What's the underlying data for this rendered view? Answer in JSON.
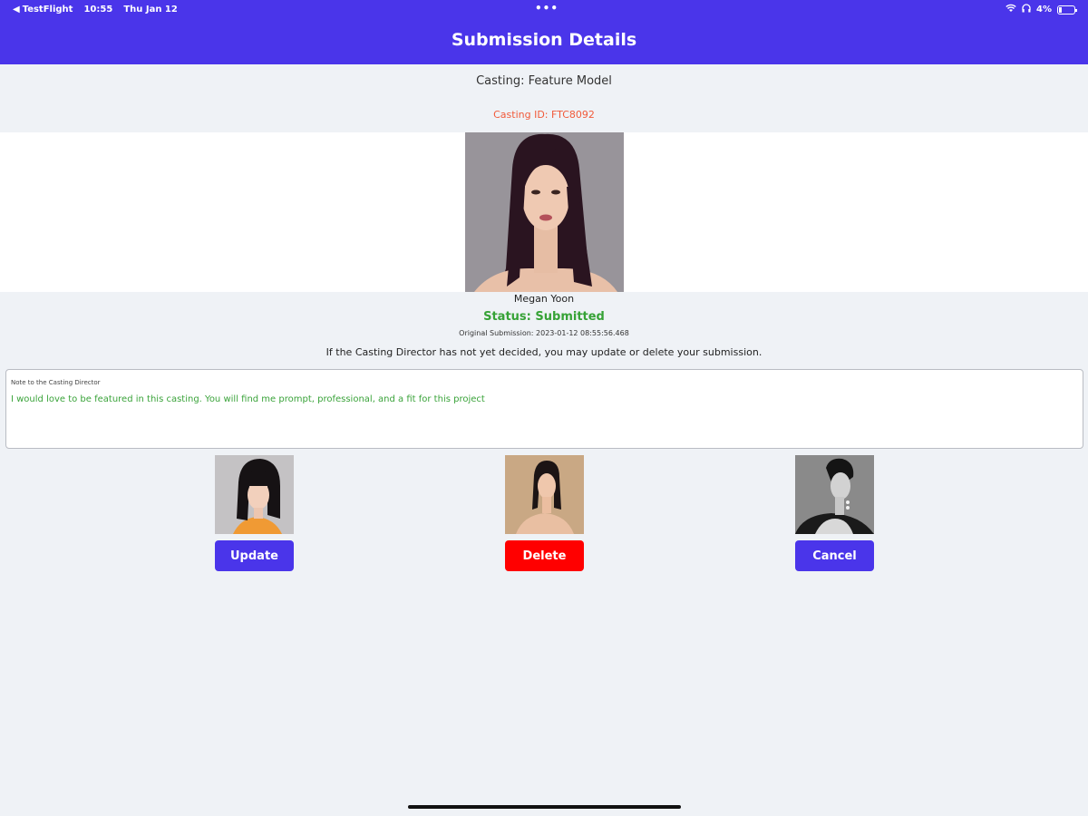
{
  "status_bar": {
    "back_app": "TestFlight",
    "time": "10:55",
    "date": "Thu Jan 12",
    "dots": "•••",
    "battery": "4%"
  },
  "nav": {
    "title": "Submission Details"
  },
  "casting": {
    "title": "Casting: Feature Model",
    "id_text": "Casting ID: FTC8092"
  },
  "submission": {
    "name": "Megan Yoon",
    "status": "Status: Submitted",
    "original_submission": "Original Submission: 2023-01-12 08:55:56.468",
    "info": "If the Casting Director has not yet decided, you may update or delete your submission."
  },
  "note": {
    "label": "Note to the Casting Director",
    "text": "I would love to be featured in this casting. You will find me prompt, professional, and a fit for this project"
  },
  "actions": {
    "update_label": "Update",
    "delete_label": "Delete",
    "cancel_label": "Cancel"
  },
  "colors": {
    "header": "#4a35ea",
    "update_button": "#4a35ea",
    "delete_button": "#ff0000",
    "cancel_button": "#4a35ea",
    "status_green": "#36a236",
    "casting_id": "#f15a3a"
  }
}
